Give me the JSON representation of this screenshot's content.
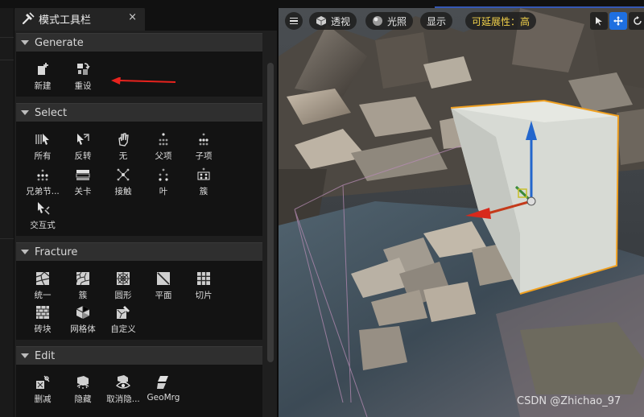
{
  "panel": {
    "tab_title": "模式工具栏",
    "tab_close": "×",
    "sections": {
      "generate": {
        "title": "Generate",
        "tools": [
          {
            "label": "新建",
            "icon": "new-icon"
          },
          {
            "label": "重设",
            "icon": "reset-icon"
          }
        ]
      },
      "select": {
        "title": "Select",
        "tools": [
          {
            "label": "所有",
            "icon": "select-all-icon"
          },
          {
            "label": "反转",
            "icon": "invert-icon"
          },
          {
            "label": "无",
            "icon": "select-none-icon"
          },
          {
            "label": "父项",
            "icon": "parent-icon"
          },
          {
            "label": "子项",
            "icon": "children-icon"
          },
          {
            "label": "兄弟节...",
            "icon": "siblings-icon"
          },
          {
            "label": "关卡",
            "icon": "level-icon"
          },
          {
            "label": "接触",
            "icon": "contact-icon"
          },
          {
            "label": "叶",
            "icon": "leaf-icon"
          },
          {
            "label": "簇",
            "icon": "cluster-icon"
          },
          {
            "label": "交互式",
            "icon": "interactive-icon"
          }
        ]
      },
      "fracture": {
        "title": "Fracture",
        "tools": [
          {
            "label": "统一",
            "icon": "uniform-icon"
          },
          {
            "label": "簇",
            "icon": "cluster-fracture-icon"
          },
          {
            "label": "圆形",
            "icon": "radial-icon"
          },
          {
            "label": "平面",
            "icon": "plane-icon"
          },
          {
            "label": "切片",
            "icon": "slice-icon"
          },
          {
            "label": "砖块",
            "icon": "brick-icon"
          },
          {
            "label": "网格体",
            "icon": "mesh-icon"
          },
          {
            "label": "自定义",
            "icon": "custom-icon"
          }
        ]
      },
      "edit": {
        "title": "Edit",
        "tools": [
          {
            "label": "删减",
            "icon": "prune-icon"
          },
          {
            "label": "隐藏",
            "icon": "hide-icon"
          },
          {
            "label": "取消隐...",
            "icon": "unhide-icon"
          },
          {
            "label": "GeoMrg",
            "icon": "geomerge-icon"
          }
        ]
      }
    }
  },
  "viewport": {
    "toolbar": {
      "perspective": "透视",
      "lighting": "光照",
      "show": "显示",
      "scalability": "可延展性：高"
    },
    "watermark": "CSDN @Zhichao_97"
  },
  "colors": {
    "accent_blue": "#1e6fe0",
    "scalability_yellow": "#f3d24a",
    "annotation_red": "#e8231e",
    "selection_orange": "#f0a020"
  }
}
